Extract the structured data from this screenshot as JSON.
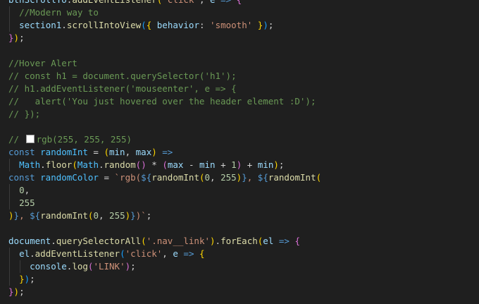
{
  "editor": {
    "colors": {
      "background": "#1f1f1f",
      "plain": "#d4d4d4",
      "comment": "#6a9955",
      "keyword": "#569cd6",
      "variable": "#9cdcfe",
      "constant": "#4fc1ff",
      "function": "#dcdcaa",
      "string": "#ce9178",
      "number": "#b5cea8",
      "template": "#569cd6",
      "bracket1": "#ffd700",
      "bracket2": "#da70d6",
      "bracket3": "#179fff"
    },
    "swatch_color": "#ffffff",
    "lines": [
      {
        "indent": 0,
        "tokens": [
          [
            "btnScrollTo",
            "variable"
          ],
          [
            ".",
            "plain"
          ],
          [
            "addEventListener",
            "function"
          ],
          [
            "(",
            "bracket1"
          ],
          [
            "'click'",
            "string"
          ],
          [
            ", ",
            "plain"
          ],
          [
            "e",
            "variable"
          ],
          [
            " => ",
            "keyword"
          ],
          [
            "{",
            "bracket2"
          ]
        ]
      },
      {
        "indent": 1,
        "tokens": [
          [
            "//Modern way to",
            "comment"
          ]
        ]
      },
      {
        "indent": 1,
        "tokens": [
          [
            "section1",
            "variable"
          ],
          [
            ".",
            "plain"
          ],
          [
            "scrollIntoView",
            "function"
          ],
          [
            "(",
            "bracket3"
          ],
          [
            "{ ",
            "bracket1"
          ],
          [
            "behavior",
            "variable"
          ],
          [
            ": ",
            "plain"
          ],
          [
            "'smooth'",
            "string"
          ],
          [
            " }",
            "bracket1"
          ],
          [
            ")",
            "bracket3"
          ],
          [
            ";",
            "plain"
          ]
        ]
      },
      {
        "indent": 0,
        "tokens": [
          [
            "}",
            "bracket2"
          ],
          [
            ")",
            "bracket1"
          ],
          [
            ";",
            "plain"
          ]
        ]
      },
      {
        "indent": 0,
        "tokens": []
      },
      {
        "indent": 0,
        "tokens": [
          [
            "//Hover Alert",
            "comment"
          ]
        ]
      },
      {
        "indent": 0,
        "tokens": [
          [
            "// const h1 = document.querySelector('h1');",
            "comment"
          ]
        ]
      },
      {
        "indent": 0,
        "tokens": [
          [
            "// h1.addEventListener('mouseenter', e => {",
            "comment"
          ]
        ]
      },
      {
        "indent": 0,
        "tokens": [
          [
            "//   alert('You just hovered over the header element :D');",
            "comment"
          ]
        ]
      },
      {
        "indent": 0,
        "tokens": [
          [
            "// });",
            "comment"
          ]
        ]
      },
      {
        "indent": 0,
        "tokens": []
      },
      {
        "indent": 0,
        "tokens": [
          [
            "// ",
            "comment"
          ],
          [
            "",
            "swatch"
          ],
          [
            "rgb(255, 255, 255)",
            "comment"
          ]
        ]
      },
      {
        "indent": 0,
        "tokens": [
          [
            "const ",
            "keyword"
          ],
          [
            "randomInt",
            "constant"
          ],
          [
            " = ",
            "plain"
          ],
          [
            "(",
            "bracket1"
          ],
          [
            "min",
            "variable"
          ],
          [
            ", ",
            "plain"
          ],
          [
            "max",
            "variable"
          ],
          [
            ")",
            "bracket1"
          ],
          [
            " =>",
            "keyword"
          ]
        ]
      },
      {
        "indent": 1,
        "tokens": [
          [
            "Math",
            "constant"
          ],
          [
            ".",
            "plain"
          ],
          [
            "floor",
            "function"
          ],
          [
            "(",
            "bracket1"
          ],
          [
            "Math",
            "constant"
          ],
          [
            ".",
            "plain"
          ],
          [
            "random",
            "function"
          ],
          [
            "()",
            "bracket2"
          ],
          [
            " * ",
            "plain"
          ],
          [
            "(",
            "bracket2"
          ],
          [
            "max",
            "variable"
          ],
          [
            " - ",
            "plain"
          ],
          [
            "min",
            "variable"
          ],
          [
            " + ",
            "plain"
          ],
          [
            "1",
            "number"
          ],
          [
            ")",
            "bracket2"
          ],
          [
            " + ",
            "plain"
          ],
          [
            "min",
            "variable"
          ],
          [
            ")",
            "bracket1"
          ],
          [
            ";",
            "plain"
          ]
        ]
      },
      {
        "indent": 0,
        "tokens": [
          [
            "const ",
            "keyword"
          ],
          [
            "randomColor",
            "constant"
          ],
          [
            " = ",
            "plain"
          ],
          [
            "`rgb(",
            "string"
          ],
          [
            "${",
            "template"
          ],
          [
            "randomInt",
            "function"
          ],
          [
            "(",
            "bracket1"
          ],
          [
            "0",
            "number"
          ],
          [
            ", ",
            "plain"
          ],
          [
            "255",
            "number"
          ],
          [
            ")",
            "bracket1"
          ],
          [
            "}",
            "template"
          ],
          [
            ", ",
            "string"
          ],
          [
            "${",
            "template"
          ],
          [
            "randomInt",
            "function"
          ],
          [
            "(",
            "bracket1"
          ]
        ]
      },
      {
        "indent": 1,
        "tokens": [
          [
            "0",
            "number"
          ],
          [
            ",",
            "plain"
          ]
        ]
      },
      {
        "indent": 1,
        "tokens": [
          [
            "255",
            "number"
          ]
        ]
      },
      {
        "indent": 0,
        "tokens": [
          [
            ")",
            "bracket1"
          ],
          [
            "}",
            "template"
          ],
          [
            ", ",
            "string"
          ],
          [
            "${",
            "template"
          ],
          [
            "randomInt",
            "function"
          ],
          [
            "(",
            "bracket1"
          ],
          [
            "0",
            "number"
          ],
          [
            ", ",
            "plain"
          ],
          [
            "255",
            "number"
          ],
          [
            ")",
            "bracket1"
          ],
          [
            "}",
            "template"
          ],
          [
            ")`",
            "string"
          ],
          [
            ";",
            "plain"
          ]
        ]
      },
      {
        "indent": 0,
        "tokens": []
      },
      {
        "indent": 0,
        "tokens": [
          [
            "document",
            "variable"
          ],
          [
            ".",
            "plain"
          ],
          [
            "querySelectorAll",
            "function"
          ],
          [
            "(",
            "bracket1"
          ],
          [
            "'.nav__link'",
            "string"
          ],
          [
            ")",
            "bracket1"
          ],
          [
            ".",
            "plain"
          ],
          [
            "forEach",
            "function"
          ],
          [
            "(",
            "bracket1"
          ],
          [
            "el",
            "variable"
          ],
          [
            " => ",
            "keyword"
          ],
          [
            "{",
            "bracket2"
          ]
        ]
      },
      {
        "indent": 1,
        "tokens": [
          [
            "el",
            "variable"
          ],
          [
            ".",
            "plain"
          ],
          [
            "addEventListener",
            "function"
          ],
          [
            "(",
            "bracket3"
          ],
          [
            "'click'",
            "string"
          ],
          [
            ", ",
            "plain"
          ],
          [
            "e",
            "variable"
          ],
          [
            " => ",
            "keyword"
          ],
          [
            "{",
            "bracket1"
          ]
        ]
      },
      {
        "indent": 2,
        "tokens": [
          [
            "console",
            "variable"
          ],
          [
            ".",
            "plain"
          ],
          [
            "log",
            "function"
          ],
          [
            "(",
            "bracket2"
          ],
          [
            "'LINK'",
            "string"
          ],
          [
            ")",
            "bracket2"
          ],
          [
            ";",
            "plain"
          ]
        ]
      },
      {
        "indent": 1,
        "tokens": [
          [
            "}",
            "bracket1"
          ],
          [
            ")",
            "bracket3"
          ],
          [
            ";",
            "plain"
          ]
        ]
      },
      {
        "indent": 0,
        "tokens": [
          [
            "}",
            "bracket2"
          ],
          [
            ")",
            "bracket1"
          ],
          [
            ";",
            "plain"
          ]
        ]
      }
    ]
  }
}
